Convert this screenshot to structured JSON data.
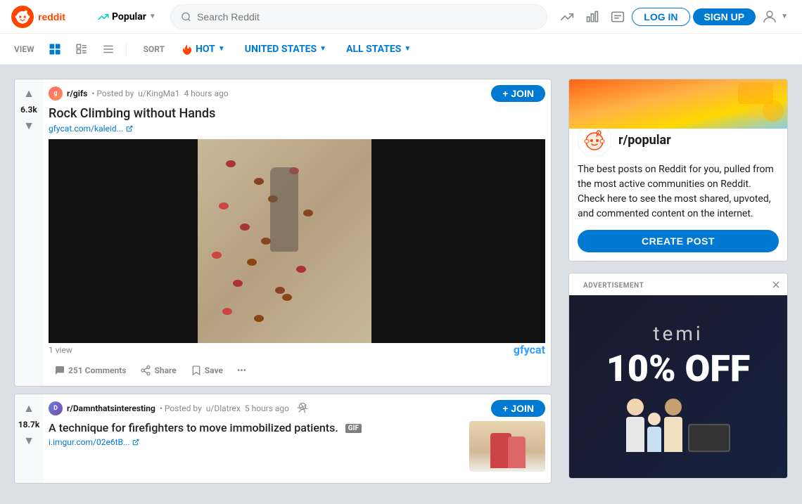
{
  "header": {
    "logo_alt": "Reddit",
    "popular_label": "Popular",
    "search_placeholder": "Search Reddit",
    "login_label": "LOG IN",
    "signup_label": "SIGN UP"
  },
  "toolbar": {
    "view_label": "VIEW",
    "sort_label": "SORT",
    "hot_label": "HOT",
    "location_label": "UNITED STATES",
    "states_label": "ALL STATES"
  },
  "posts": [
    {
      "id": "post1",
      "subreddit": "r/gifs",
      "author": "u/KingMa1",
      "time": "4 hours ago",
      "title": "Rock Climbing without Hands",
      "link": "gfycat.com/kaleid...",
      "vote_count": "6.3k",
      "view_count": "1 view",
      "comments": "251 Comments",
      "share": "Share",
      "save": "Save",
      "join": "+ JOIN",
      "gfycat": "gfycat"
    },
    {
      "id": "post2",
      "subreddit": "r/Damnthatsinteresting",
      "author": "u/Dlatrex",
      "time": "5 hours ago",
      "title": "A technique for firefighters to move immobilized patients.",
      "gif_badge": "GIF",
      "link": "i.imgur.com/02e6tB...",
      "vote_count": "18.7k",
      "join": "+ JOIN"
    }
  ],
  "sidebar": {
    "subreddit_name": "r/popular",
    "description": "The best posts on Reddit for you, pulled from the most active communities on Reddit. Check here to see the most shared, upvoted, and commented content on the internet.",
    "create_post_label": "CREATE POST",
    "ad_label": "ADVERTISEMENT",
    "ad_brand": "temi",
    "ad_offer": "10% OFF"
  },
  "icons": {
    "upvote": "▲",
    "downvote": "▼",
    "external_link": "↗",
    "comment": "💬",
    "share_icon": "↑",
    "save_icon": "⊿",
    "more": "•••",
    "search": "🔍"
  }
}
